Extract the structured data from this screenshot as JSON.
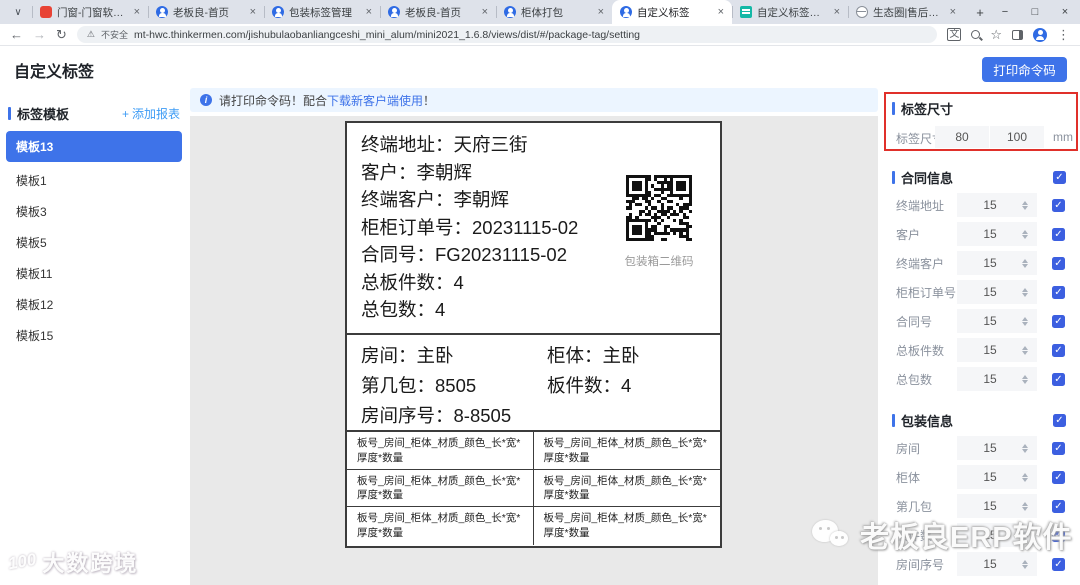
{
  "browser": {
    "tabs": [
      {
        "title": "门窗-门窗软件 · Teambiti"
      },
      {
        "title": "老板良-首页"
      },
      {
        "title": "包装标签管理"
      },
      {
        "title": "老板良-首页"
      },
      {
        "title": "柜体打包"
      },
      {
        "title": "自定义标签"
      },
      {
        "title": "自定义标签使用方法"
      },
      {
        "title": "生态圈|售后工单详情"
      }
    ],
    "security_text": "不安全",
    "url": "mt-hwc.thinkermen.com/jishubulaobanliangceshi_mini_alum/mini2021_1.6.8/views/dist/#/package-tag/setting"
  },
  "icons": {
    "back": "←",
    "forward": "→",
    "reload": "↻",
    "warning": "⚠",
    "star": "☆",
    "menu": "⋮",
    "minimize": "−",
    "maximize": "□",
    "close": "×",
    "tab_close": "×",
    "new_tab": "+",
    "add": "+",
    "check": "✓",
    "chevron_down": "∨",
    "info": "i",
    "translate": "文"
  },
  "header": {
    "title": "自定义标签",
    "print_button": "打印命令码"
  },
  "sidebar": {
    "section_title": "标签模板",
    "add_link": "添加报表",
    "items": [
      {
        "label": "模板13"
      },
      {
        "label": "模板1"
      },
      {
        "label": "模板3"
      },
      {
        "label": "模板5"
      },
      {
        "label": "模板11"
      },
      {
        "label": "模板12"
      },
      {
        "label": "模板15"
      }
    ]
  },
  "banner": {
    "text_before": "请打印命令码！配合",
    "link_text": "下载新客户端使用",
    "text_after": "！"
  },
  "label_preview": {
    "contract_lines": [
      "终端地址：天府三街",
      "客户：李朝辉",
      "终端客户：李朝辉",
      "柜柜订单号：20231115-02",
      "合同号：FG20231115-02",
      "总板件数：4",
      "总包数：4"
    ],
    "qr_caption": "包装箱二维码",
    "package_lines": [
      "房间：主卧",
      "柜体：主卧",
      "第几包：8505",
      "板件数：4",
      "房间序号：8-8505"
    ],
    "grid_cell": "板号_房间_柜体_材质_颜色_长*宽*厚度*数量"
  },
  "panel": {
    "size_section": {
      "title": "标签尺寸",
      "row_label": "标签尺寸",
      "width_value": "80",
      "height_value": "100",
      "unit": "mm"
    },
    "contract_section": {
      "title": "合同信息",
      "rows": [
        {
          "label": "终端地址",
          "value": "15"
        },
        {
          "label": "客户",
          "value": "15"
        },
        {
          "label": "终端客户",
          "value": "15"
        },
        {
          "label": "柜柜订单号",
          "value": "15"
        },
        {
          "label": "合同号",
          "value": "15"
        },
        {
          "label": "总板件数",
          "value": "15"
        },
        {
          "label": "总包数",
          "value": "15"
        }
      ]
    },
    "packaging_section": {
      "title": "包装信息",
      "rows": [
        {
          "label": "房间",
          "value": "15"
        },
        {
          "label": "柜体",
          "value": "15"
        },
        {
          "label": "第几包",
          "value": "15"
        },
        {
          "label": "板件数",
          "value": "15"
        },
        {
          "label": "房间序号",
          "value": "15"
        }
      ]
    }
  },
  "watermarks": {
    "wechat_text": "老板良ERP软件",
    "brand_logo": "100",
    "brand_text": "大数跨境"
  }
}
